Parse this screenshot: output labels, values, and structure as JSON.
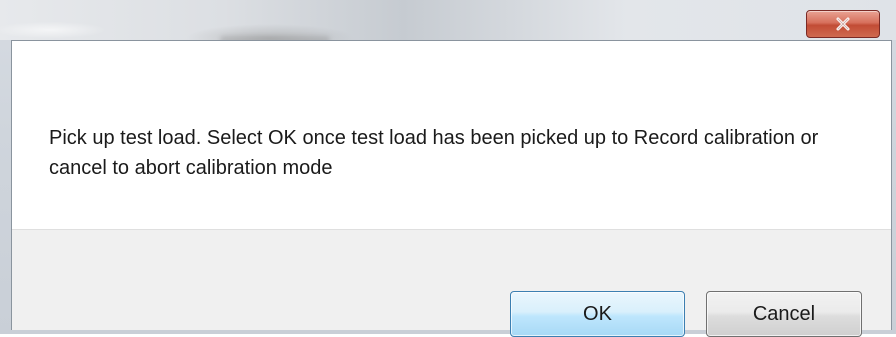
{
  "dialog": {
    "message": "Pick up test load.  Select OK once test load has been picked up to Record calibration or cancel to abort calibration mode",
    "buttons": {
      "ok_label": "OK",
      "cancel_label": "Cancel"
    },
    "close_icon": "close-icon"
  },
  "colors": {
    "close_button_red": "#c24c35",
    "ok_button_border": "#3c7fb1",
    "button_area_background": "#f0f0f0"
  }
}
